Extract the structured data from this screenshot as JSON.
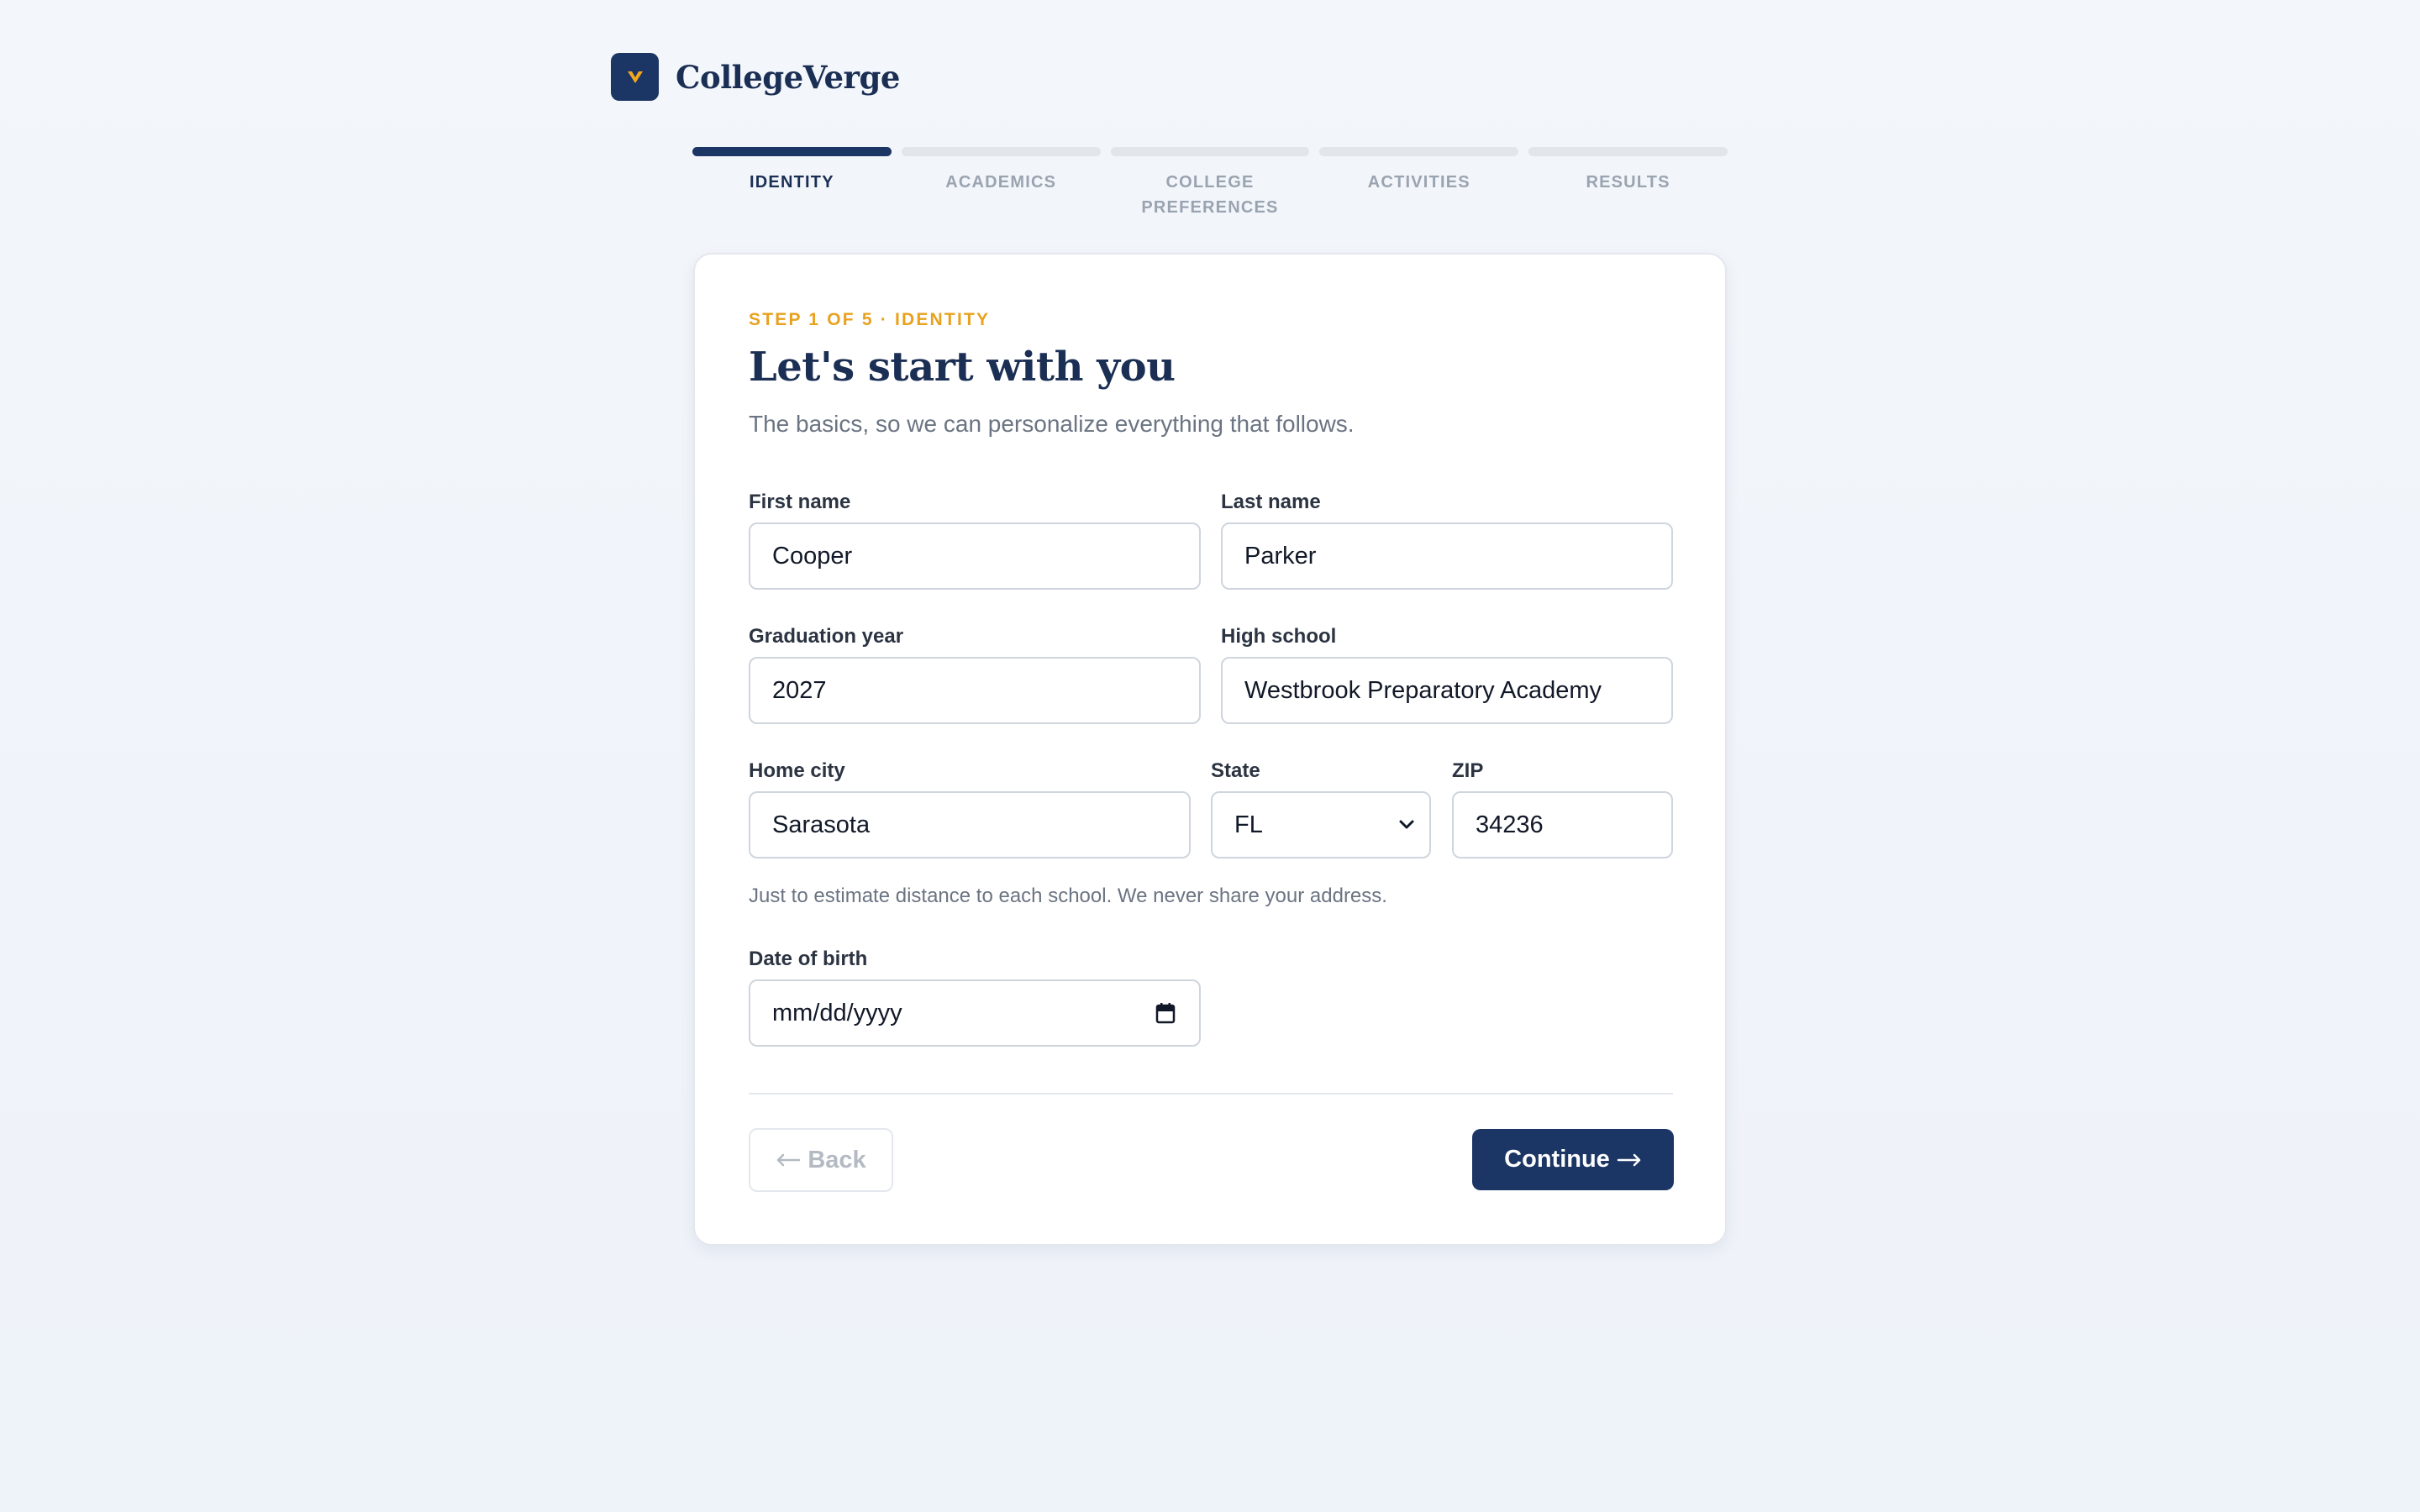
{
  "brand": {
    "name": "CollegeVerge",
    "icon": "chevron-v-icon",
    "accent_color": "#e8a21e",
    "primary_color": "#1b3564"
  },
  "stepper": {
    "steps": [
      {
        "label": "IDENTITY",
        "active": true
      },
      {
        "label": "ACADEMICS",
        "active": false
      },
      {
        "label": "COLLEGE PREFERENCES",
        "active": false
      },
      {
        "label": "ACTIVITIES",
        "active": false
      },
      {
        "label": "RESULTS",
        "active": false
      }
    ]
  },
  "form": {
    "eyebrow": "STEP 1 OF 5 · IDENTITY",
    "title": "Let's start with you",
    "subtitle": "The basics, so we can personalize everything that follows.",
    "fields": {
      "first_name": {
        "label": "First name",
        "value": "Cooper"
      },
      "last_name": {
        "label": "Last name",
        "value": "Parker"
      },
      "graduation_year": {
        "label": "Graduation year",
        "value": "2027"
      },
      "high_school": {
        "label": "High school",
        "value": "Westbrook Preparatory Academy"
      },
      "home_city": {
        "label": "Home city",
        "value": "Sarasota"
      },
      "state": {
        "label": "State",
        "value": "FL"
      },
      "zip": {
        "label": "ZIP",
        "value": "34236"
      },
      "dob": {
        "label": "Date of birth",
        "placeholder": "mm/dd/yyyy"
      }
    },
    "helper": "Just to estimate distance to each school. We never share your address."
  },
  "actions": {
    "back_label": "Back",
    "continue_label": "Continue"
  }
}
